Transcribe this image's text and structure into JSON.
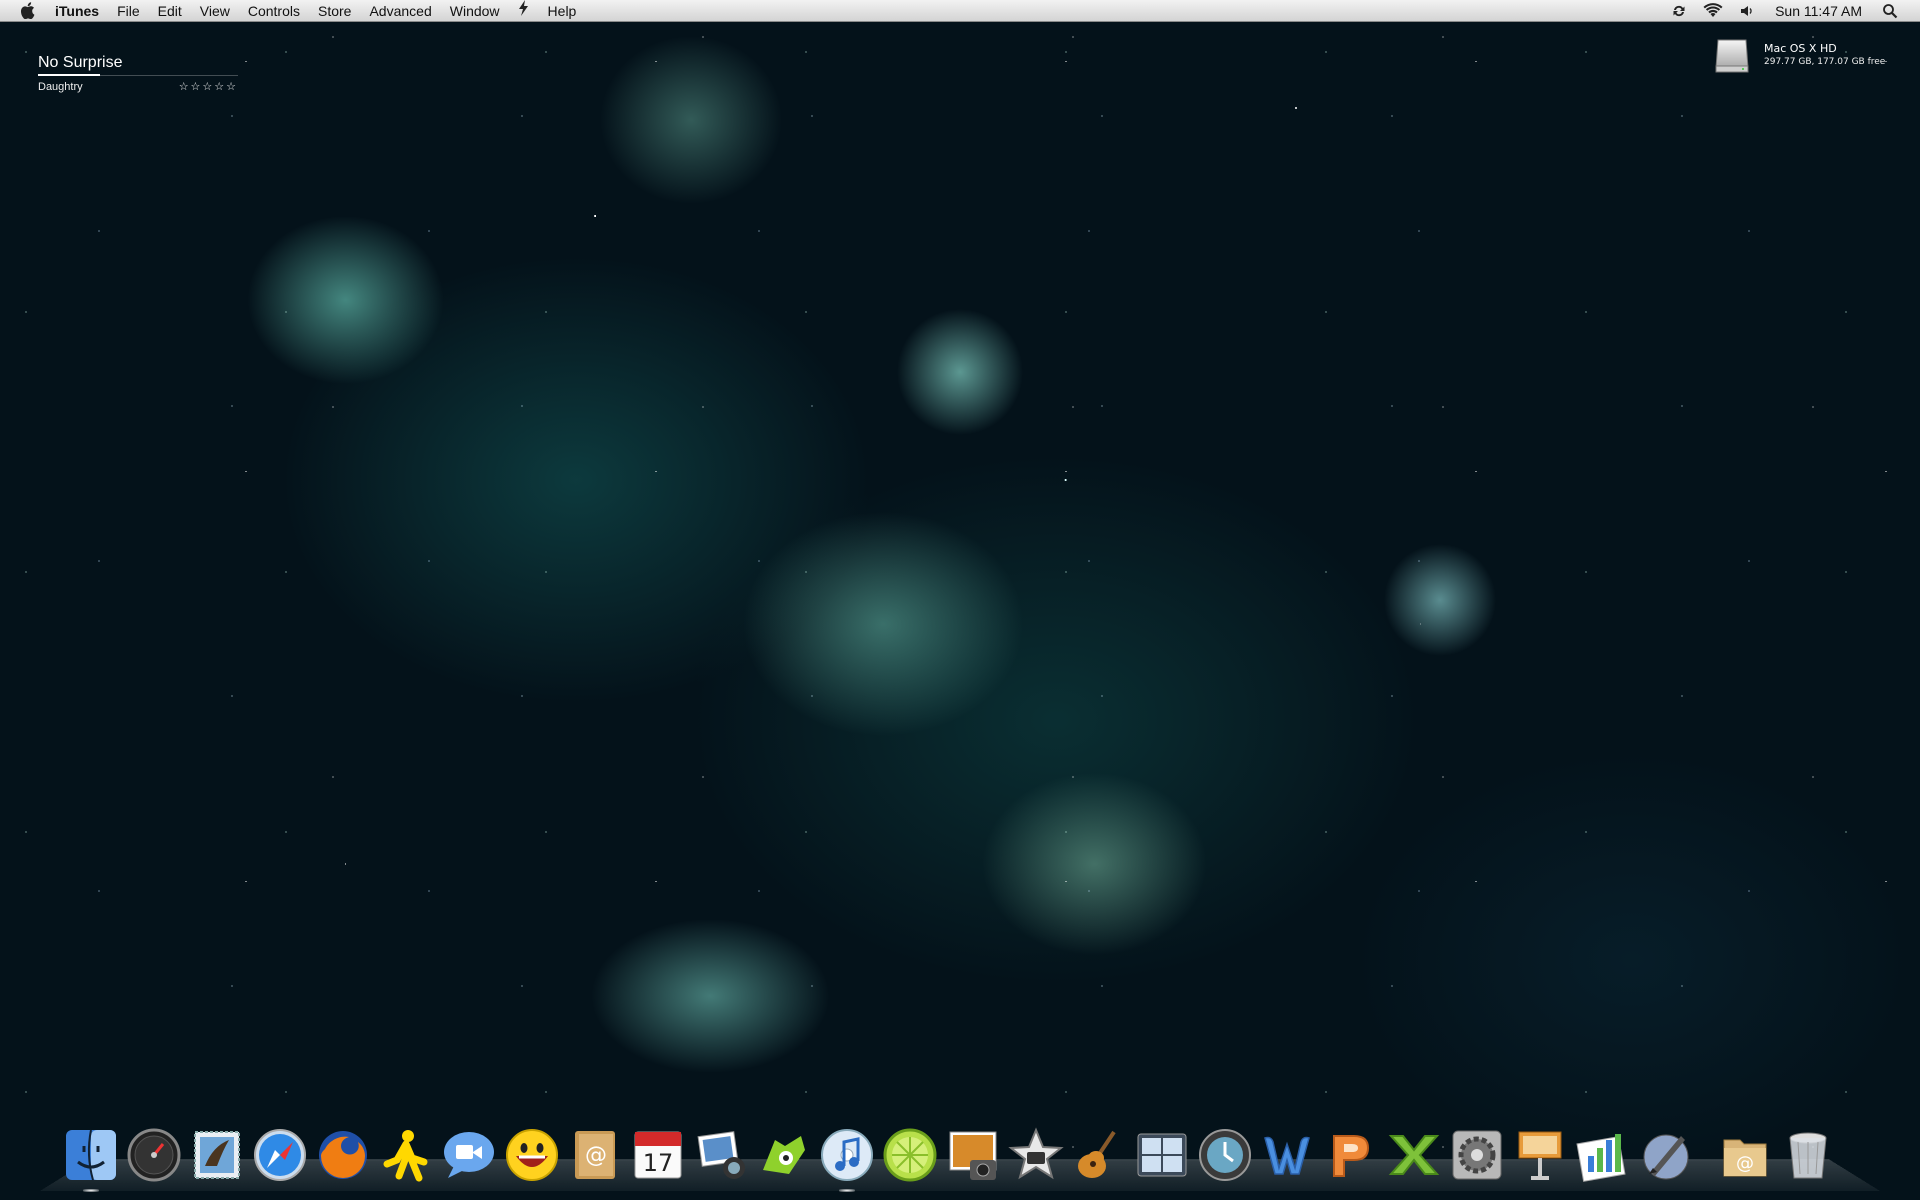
{
  "menubar": {
    "app_name": "iTunes",
    "items": [
      "File",
      "Edit",
      "View",
      "Controls",
      "Store",
      "Advanced",
      "Window",
      "Help"
    ],
    "clock": "Sun 11:47 AM",
    "status_icons": [
      "sync-icon",
      "wifi-icon",
      "volume-icon"
    ]
  },
  "now_playing": {
    "title": "No Surprise",
    "artist": "Daughtry",
    "rating": "☆☆☆☆☆"
  },
  "drive": {
    "name": "Mac OS X HD",
    "info": "297.77 GB, 177.07 GB free"
  },
  "dock": {
    "apps": [
      {
        "name": "finder-icon",
        "running": true
      },
      {
        "name": "dashboard-icon",
        "running": false
      },
      {
        "name": "mail-icon",
        "running": false
      },
      {
        "name": "safari-icon",
        "running": false
      },
      {
        "name": "firefox-icon",
        "running": false
      },
      {
        "name": "aim-icon",
        "running": false
      },
      {
        "name": "ichat-icon",
        "running": false
      },
      {
        "name": "yahoo-messenger-icon",
        "running": false
      },
      {
        "name": "address-book-icon",
        "running": false
      },
      {
        "name": "ical-icon",
        "running": false
      },
      {
        "name": "iphoto-icon",
        "running": false
      },
      {
        "name": "adium-icon",
        "running": false
      },
      {
        "name": "itunes-icon",
        "running": true
      },
      {
        "name": "limewire-icon",
        "running": false
      },
      {
        "name": "photo-booth-icon",
        "running": false
      },
      {
        "name": "imovie-icon",
        "running": false
      },
      {
        "name": "garageband-icon",
        "running": false
      },
      {
        "name": "spaces-icon",
        "running": false
      },
      {
        "name": "time-machine-icon",
        "running": false
      },
      {
        "name": "word-icon",
        "running": false
      },
      {
        "name": "powerpoint-icon",
        "running": false
      },
      {
        "name": "excel-icon",
        "running": false
      },
      {
        "name": "system-preferences-icon",
        "running": false
      },
      {
        "name": "keynote-icon",
        "running": false
      },
      {
        "name": "numbers-icon",
        "running": false
      },
      {
        "name": "script-editor-icon",
        "running": false
      }
    ],
    "folders": [
      {
        "name": "documents-stack-icon"
      },
      {
        "name": "trash-icon"
      }
    ]
  }
}
